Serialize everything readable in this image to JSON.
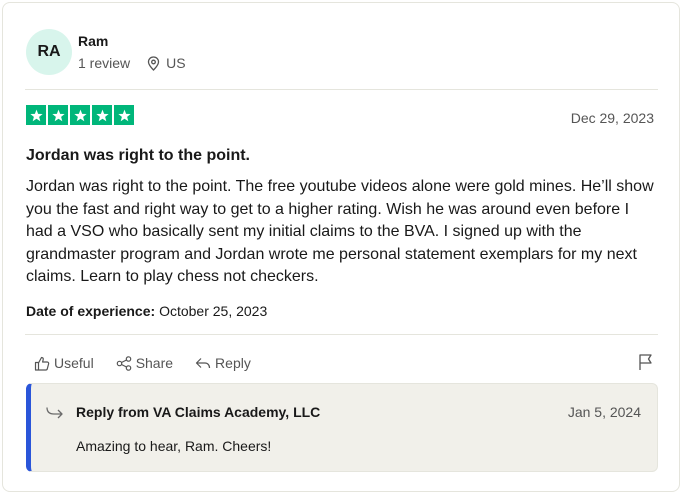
{
  "reviewer": {
    "initials": "RA",
    "name": "Ram",
    "review_count": "1 review",
    "country": "US"
  },
  "review": {
    "rating": 5,
    "rating_color": "#00b67a",
    "date": "Dec 29, 2023",
    "title": "Jordan was right to the point.",
    "body": "Jordan was right to the point. The free youtube videos alone were gold mines. He’ll show you the fast and right way to get to a higher rating. Wish he was around even before I had a VSO who basically sent my initial claims to the BVA. I signed up with the grandmaster program and Jordan wrote me personal statement exemplars for my next claims. Learn to play chess not checkers.",
    "experience_label": "Date of experience:",
    "experience_date": "October 25, 2023"
  },
  "actions": {
    "useful": "Useful",
    "share": "Share",
    "reply": "Reply"
  },
  "company_reply": {
    "from": "Reply from VA Claims Academy, LLC",
    "date": "Jan 5, 2024",
    "text": "Amazing to hear, Ram. Cheers!",
    "accent_color": "#2a55d9"
  }
}
